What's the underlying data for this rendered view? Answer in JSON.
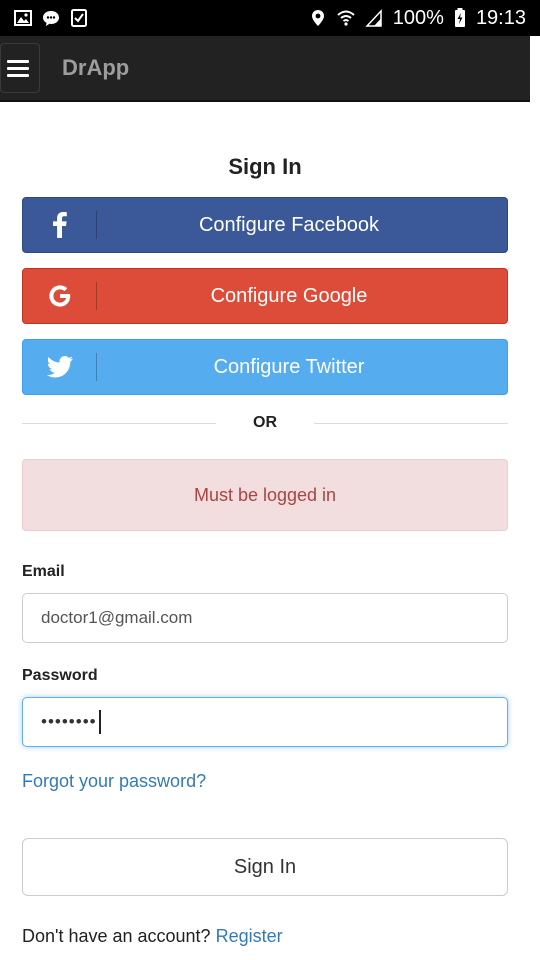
{
  "status_bar": {
    "battery": "100%",
    "time": "19:13"
  },
  "app_bar": {
    "title": "DrApp"
  },
  "page": {
    "heading": "Sign In",
    "social": [
      {
        "label": "Configure Facebook",
        "icon": "facebook-icon",
        "color": "#3b5998"
      },
      {
        "label": "Configure Google",
        "icon": "google-icon",
        "color": "#dd4b39"
      },
      {
        "label": "Configure Twitter",
        "icon": "twitter-icon",
        "color": "#55acee"
      }
    ],
    "divider_text": "OR",
    "alert": {
      "text": "Must be logged in",
      "background": "#f2dede",
      "color": "#a94442"
    },
    "email": {
      "label": "Email",
      "value": "doctor1@gmail.com"
    },
    "password": {
      "label": "Password",
      "masked_value": "••••••••"
    },
    "forgot_link": "Forgot your password?",
    "submit_label": "Sign In",
    "register_prompt": "Don't have an account?",
    "register_link": "Register",
    "link_color": "#337ab7"
  }
}
